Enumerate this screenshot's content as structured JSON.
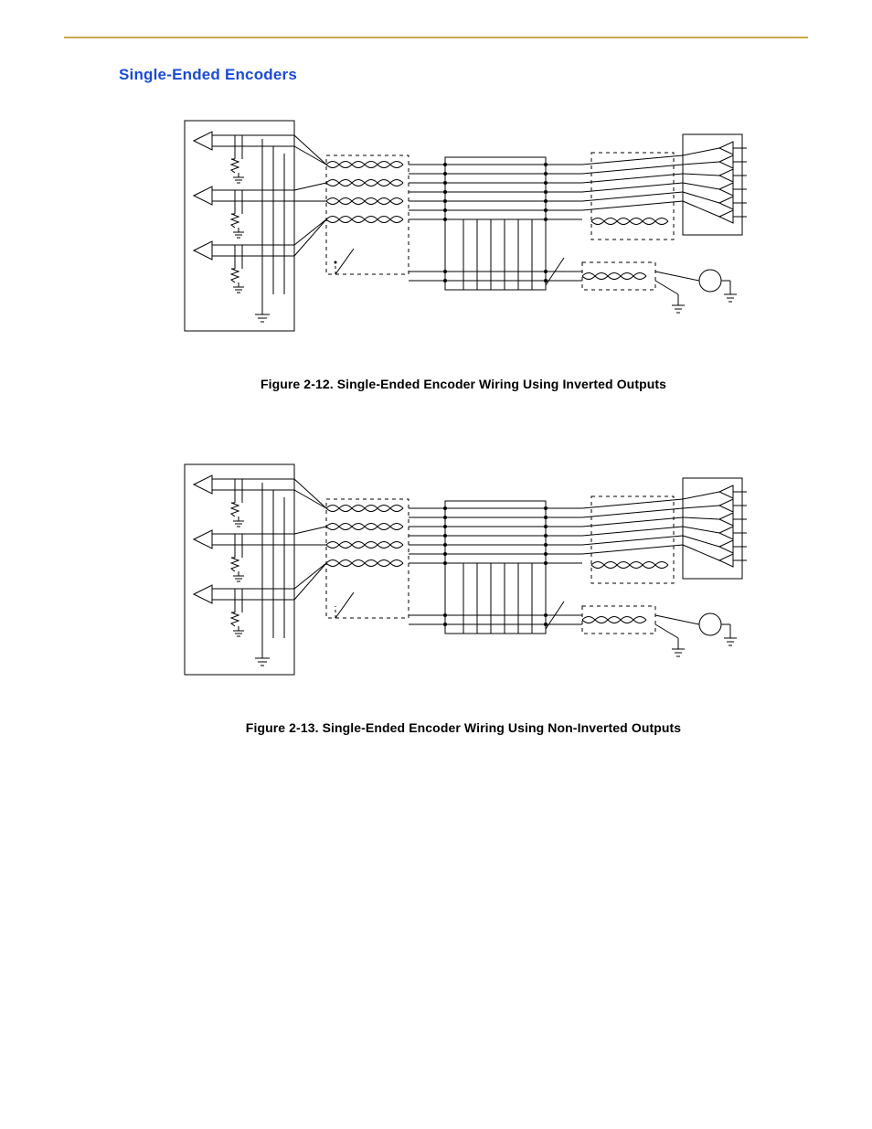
{
  "heading": "Single-Ended Encoders",
  "figure1_caption": "Figure 2-12. Single-Ended Encoder Wiring Using Inverted Outputs",
  "figure2_caption": "Figure 2-13. Single-Ended Encoder Wiring Using Non-Inverted Outputs"
}
